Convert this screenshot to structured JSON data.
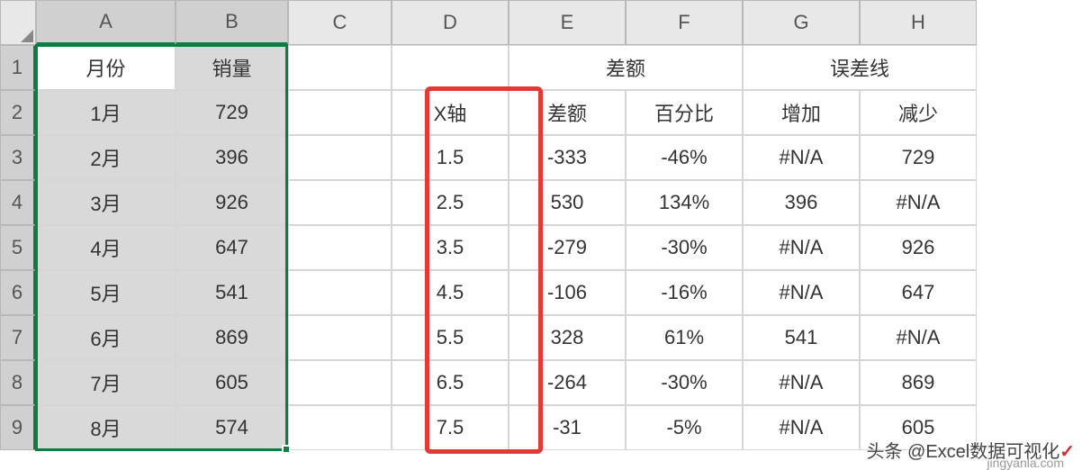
{
  "columns": [
    "A",
    "B",
    "C",
    "D",
    "E",
    "F",
    "G",
    "H"
  ],
  "rows": [
    "1",
    "2",
    "3",
    "4",
    "5",
    "6",
    "7",
    "8",
    "9"
  ],
  "headers": {
    "month": "月份",
    "sales": "销量",
    "diff_group": "差额",
    "error_group": "误差线",
    "xaxis": "X轴",
    "diff": "差额",
    "pct": "百分比",
    "inc": "增加",
    "dec": "减少"
  },
  "data": {
    "months": [
      "1月",
      "2月",
      "3月",
      "4月",
      "5月",
      "6月",
      "7月",
      "8月"
    ],
    "sales": [
      "729",
      "396",
      "926",
      "647",
      "541",
      "869",
      "605",
      "574"
    ],
    "xaxis": [
      "1.5",
      "2.5",
      "3.5",
      "4.5",
      "5.5",
      "6.5",
      "7.5"
    ],
    "diff": [
      "-333",
      "530",
      "-279",
      "-106",
      "328",
      "-264",
      "-31"
    ],
    "pct": [
      "-46%",
      "134%",
      "-30%",
      "-16%",
      "61%",
      "-30%",
      "-5%"
    ],
    "inc": [
      "#N/A",
      "396",
      "#N/A",
      "#N/A",
      "541",
      "#N/A",
      "#N/A"
    ],
    "dec": [
      "729",
      "#N/A",
      "926",
      "647",
      "#N/A",
      "869",
      "605"
    ]
  },
  "watermark": {
    "prefix": "头条 @Excel数据可视化",
    "site": "jingyanla.com"
  }
}
